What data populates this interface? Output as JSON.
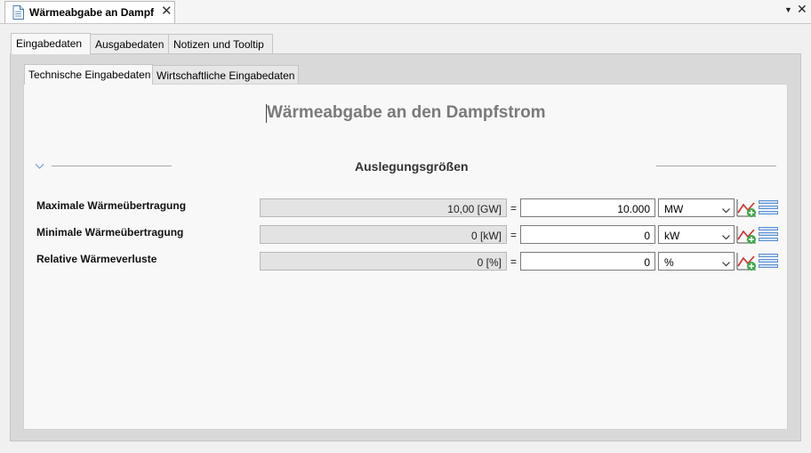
{
  "editor": {
    "tab_title": "Wärmeabgabe an Dampf",
    "close_glyph": "✕",
    "menu_glyph": "▼",
    "close_all_glyph": "✕",
    "tab_icon": "document-icon"
  },
  "outer_tabs": [
    "Eingabedaten",
    "Ausgabedaten",
    "Notizen und Tooltip"
  ],
  "inner_tabs": [
    "Technische Eingabedaten",
    "Wirtschaftliche Eingabedaten"
  ],
  "content": {
    "heading": "Wärmeabgabe an den Dampfstrom",
    "section_title": "Auslegungsgrößen",
    "rows": [
      {
        "label": "Maximale Wärmeübertragung",
        "computed": "10,00 [GW]",
        "equals": "=",
        "value": "10.000",
        "unit": "MW"
      },
      {
        "label": "Minimale Wärmeübertragung",
        "computed": "0 [kW]",
        "equals": "=",
        "value": "0",
        "unit": "kW"
      },
      {
        "label": "Relative Wärmeverluste",
        "computed": "0 [%]",
        "equals": "=",
        "value": "0",
        "unit": "%"
      }
    ]
  },
  "colors": {
    "chart_red": "#d03030",
    "plus_green": "#3aa845",
    "list_blue": "#5b8fd0",
    "heading_gray": "#7a7a7a"
  }
}
